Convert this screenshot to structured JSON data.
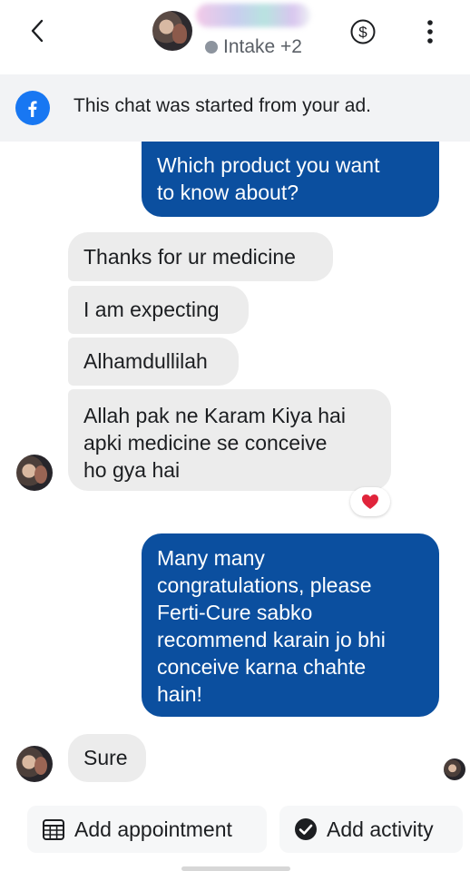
{
  "header": {
    "status": "Intake +2",
    "icons": {
      "back": "chevron-left-icon",
      "payment": "dollar-circle-icon",
      "more": "more-vertical-icon"
    }
  },
  "banner": {
    "text": "This chat was started from your ad.",
    "icon": "facebook-logo-icon"
  },
  "messages": [
    {
      "side": "out",
      "text": "Which product you want\nto know about?"
    },
    {
      "side": "in",
      "text": "Thanks for ur medicine"
    },
    {
      "side": "in",
      "text": "I am expecting"
    },
    {
      "side": "in",
      "text": "Alhamdullilah"
    },
    {
      "side": "in",
      "text": "Allah pak ne Karam Kiya hai\napki medicine se conceive\nho gya hai",
      "reaction": "❤️"
    },
    {
      "side": "out",
      "text": "Many many\ncongratulations, please\nFerti-Cure sabko\nrecommend karain jo bhi\nconceive karna chahte\nhain!"
    },
    {
      "side": "in",
      "text": "Sure"
    }
  ],
  "actions": {
    "appointment_label": "Add appointment",
    "activity_label": "Add activity"
  },
  "colors": {
    "outgoing": "#0b4f9f",
    "incoming": "#ececec",
    "accent": "#1877f2"
  }
}
